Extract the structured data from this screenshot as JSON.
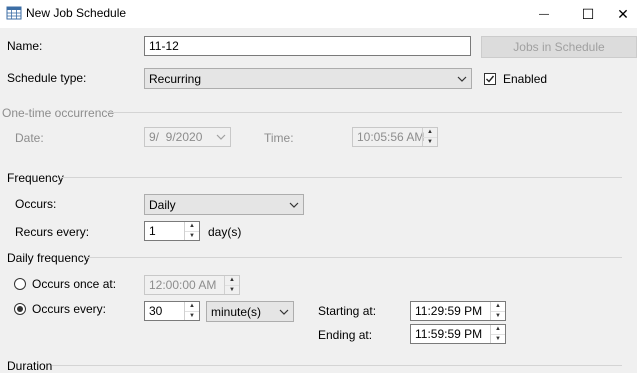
{
  "window": {
    "title": "New Job Schedule",
    "minimize_glyph": "—",
    "maximize_glyph": "☐",
    "close_glyph": "✕"
  },
  "name": {
    "label": "Name:",
    "value": "11-12"
  },
  "jobs_button": {
    "label": "Jobs in Schedule",
    "enabled": false
  },
  "schedule_type": {
    "label": "Schedule type:",
    "value": "Recurring"
  },
  "enabled": {
    "label": "Enabled",
    "checked": true
  },
  "one_time": {
    "title": "One-time occurrence",
    "date_label": "Date:",
    "date_value": "9/  9/2020",
    "time_label": "Time:",
    "time_value": "10:05:56 AM"
  },
  "frequency": {
    "title": "Frequency",
    "occurs_label": "Occurs:",
    "occurs_value": "Daily",
    "recurs_label": "Recurs every:",
    "recurs_value": "1",
    "recurs_unit": "day(s)"
  },
  "daily_frequency": {
    "title": "Daily frequency",
    "once_label": "Occurs once at:",
    "once_value": "12:00:00 AM",
    "once_selected": false,
    "every_label": "Occurs every:",
    "every_value": "30",
    "every_unit": "minute(s)",
    "every_selected": true,
    "starting_label": "Starting at:",
    "starting_value": "11:29:59 PM",
    "ending_label": "Ending at:",
    "ending_value": "11:59:59 PM"
  },
  "duration": {
    "title": "Duration"
  }
}
